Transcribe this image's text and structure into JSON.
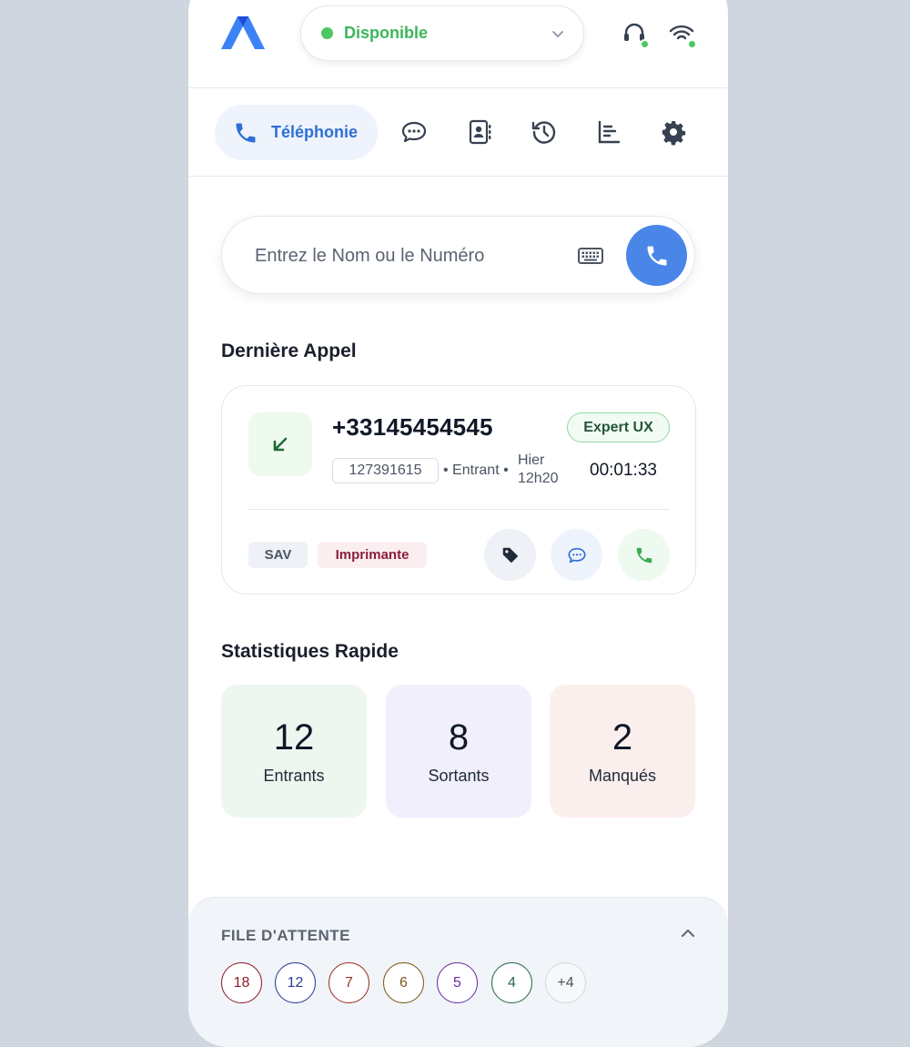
{
  "header": {
    "status": {
      "label": "Disponible",
      "color": "#4cc764"
    },
    "icons": [
      "headset-icon",
      "wifi-icon"
    ]
  },
  "tabs": [
    {
      "label": "Téléphonie",
      "icon": "phone-icon",
      "active": true
    },
    {
      "label": "",
      "icon": "chat-icon"
    },
    {
      "label": "",
      "icon": "contacts-icon"
    },
    {
      "label": "",
      "icon": "history-icon"
    },
    {
      "label": "",
      "icon": "stats-icon"
    },
    {
      "label": "",
      "icon": "settings-icon"
    }
  ],
  "search": {
    "placeholder": "Entrez le Nom ou le Numéro"
  },
  "last_call": {
    "title": "Dernière Appel",
    "number": "+33145454545",
    "tag": "Expert UX",
    "id": "127391615",
    "direction": "• Entrant •",
    "when_line1": "Hier",
    "when_line2": "12h20",
    "duration": "00:01:33",
    "chips": [
      "SAV",
      "Imprimante"
    ]
  },
  "stats": {
    "title": "Statistiques Rapide",
    "items": [
      {
        "value": "12",
        "label": "Entrants"
      },
      {
        "value": "8",
        "label": "Sortants"
      },
      {
        "value": "2",
        "label": "Manqués"
      }
    ]
  },
  "queue": {
    "title": "FILE D'ATTENTE",
    "items": [
      {
        "value": "18",
        "color": "#8b1e2a"
      },
      {
        "value": "12",
        "color": "#2d3a9a"
      },
      {
        "value": "7",
        "color": "#9a3322"
      },
      {
        "value": "6",
        "color": "#7a5a18"
      },
      {
        "value": "5",
        "color": "#6a2ea0"
      },
      {
        "value": "4",
        "color": "#2a6a4a"
      },
      {
        "value": "+4",
        "color": "#9aa3af"
      }
    ]
  }
}
